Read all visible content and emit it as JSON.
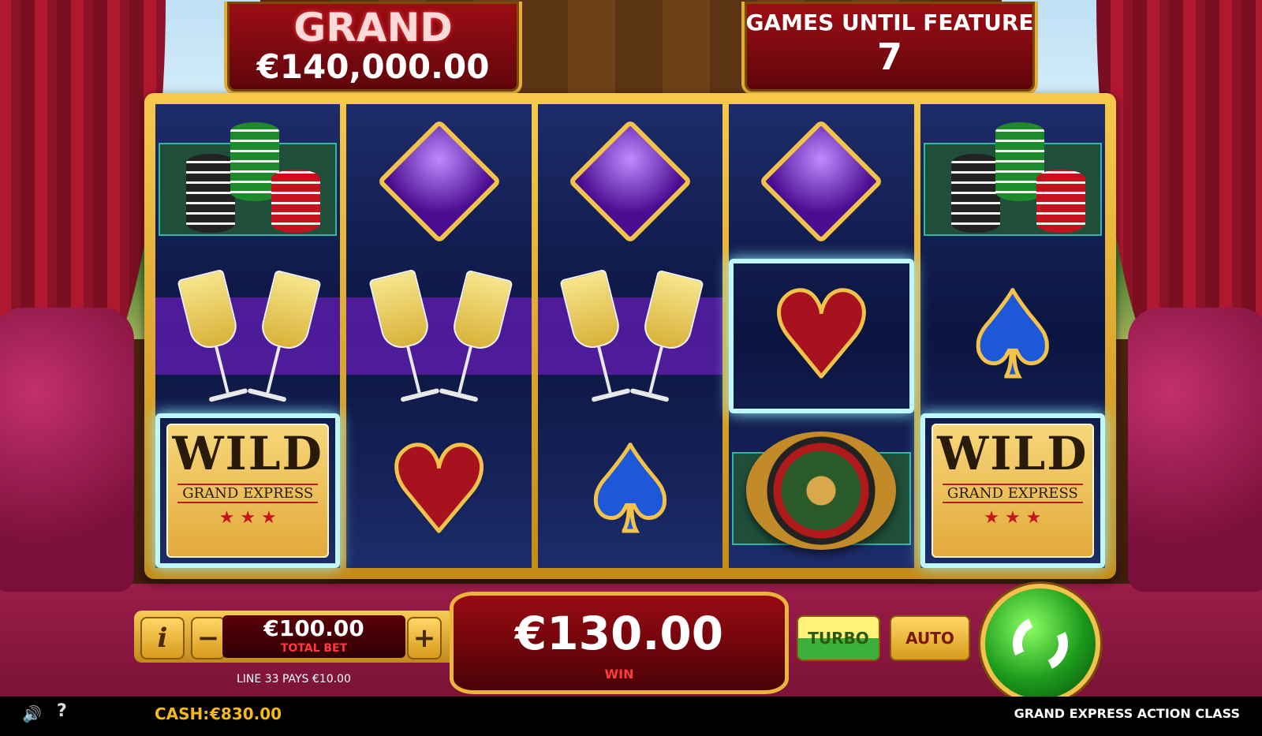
{
  "jackpot": {
    "label": "GRAND",
    "amount": "€140,000.00"
  },
  "feature": {
    "label": "GAMES UNTIL FEATURE",
    "count": "7"
  },
  "reels": [
    {
      "symbols": [
        "chips-icon",
        "champagne-icon",
        "wild-icon"
      ]
    },
    {
      "symbols": [
        "diamond-icon",
        "champagne-icon",
        "heart-icon"
      ]
    },
    {
      "symbols": [
        "diamond-icon",
        "champagne-icon",
        "spade-icon"
      ]
    },
    {
      "symbols": [
        "diamond-icon",
        "heart-icon",
        "roulette-icon"
      ]
    },
    {
      "symbols": [
        "chips-icon",
        "spade-icon",
        "wild-icon"
      ]
    }
  ],
  "wild": {
    "word": "WILD",
    "sub": "GRAND EXPRESS",
    "stars": "★ ★ ★"
  },
  "controls": {
    "info": "i",
    "minus": "−",
    "plus": "+",
    "bet_value": "€100.00",
    "bet_label": "TOTAL BET",
    "line_pays": "LINE 33 PAYS €10.00",
    "win_value": "€130.00",
    "win_label": "WIN",
    "turbo": "TURBO",
    "auto": "AUTO"
  },
  "status": {
    "cash_label": "CASH:",
    "cash_value": "€830.00",
    "game_title": "GRAND EXPRESS ACTION CLASS",
    "help": "?",
    "sound": "🔊"
  },
  "colors": {
    "gold": "#f3c24a",
    "red_panel": "#9d0d14",
    "reel_bg": "#0b1540",
    "cash": "#f5b81a"
  }
}
